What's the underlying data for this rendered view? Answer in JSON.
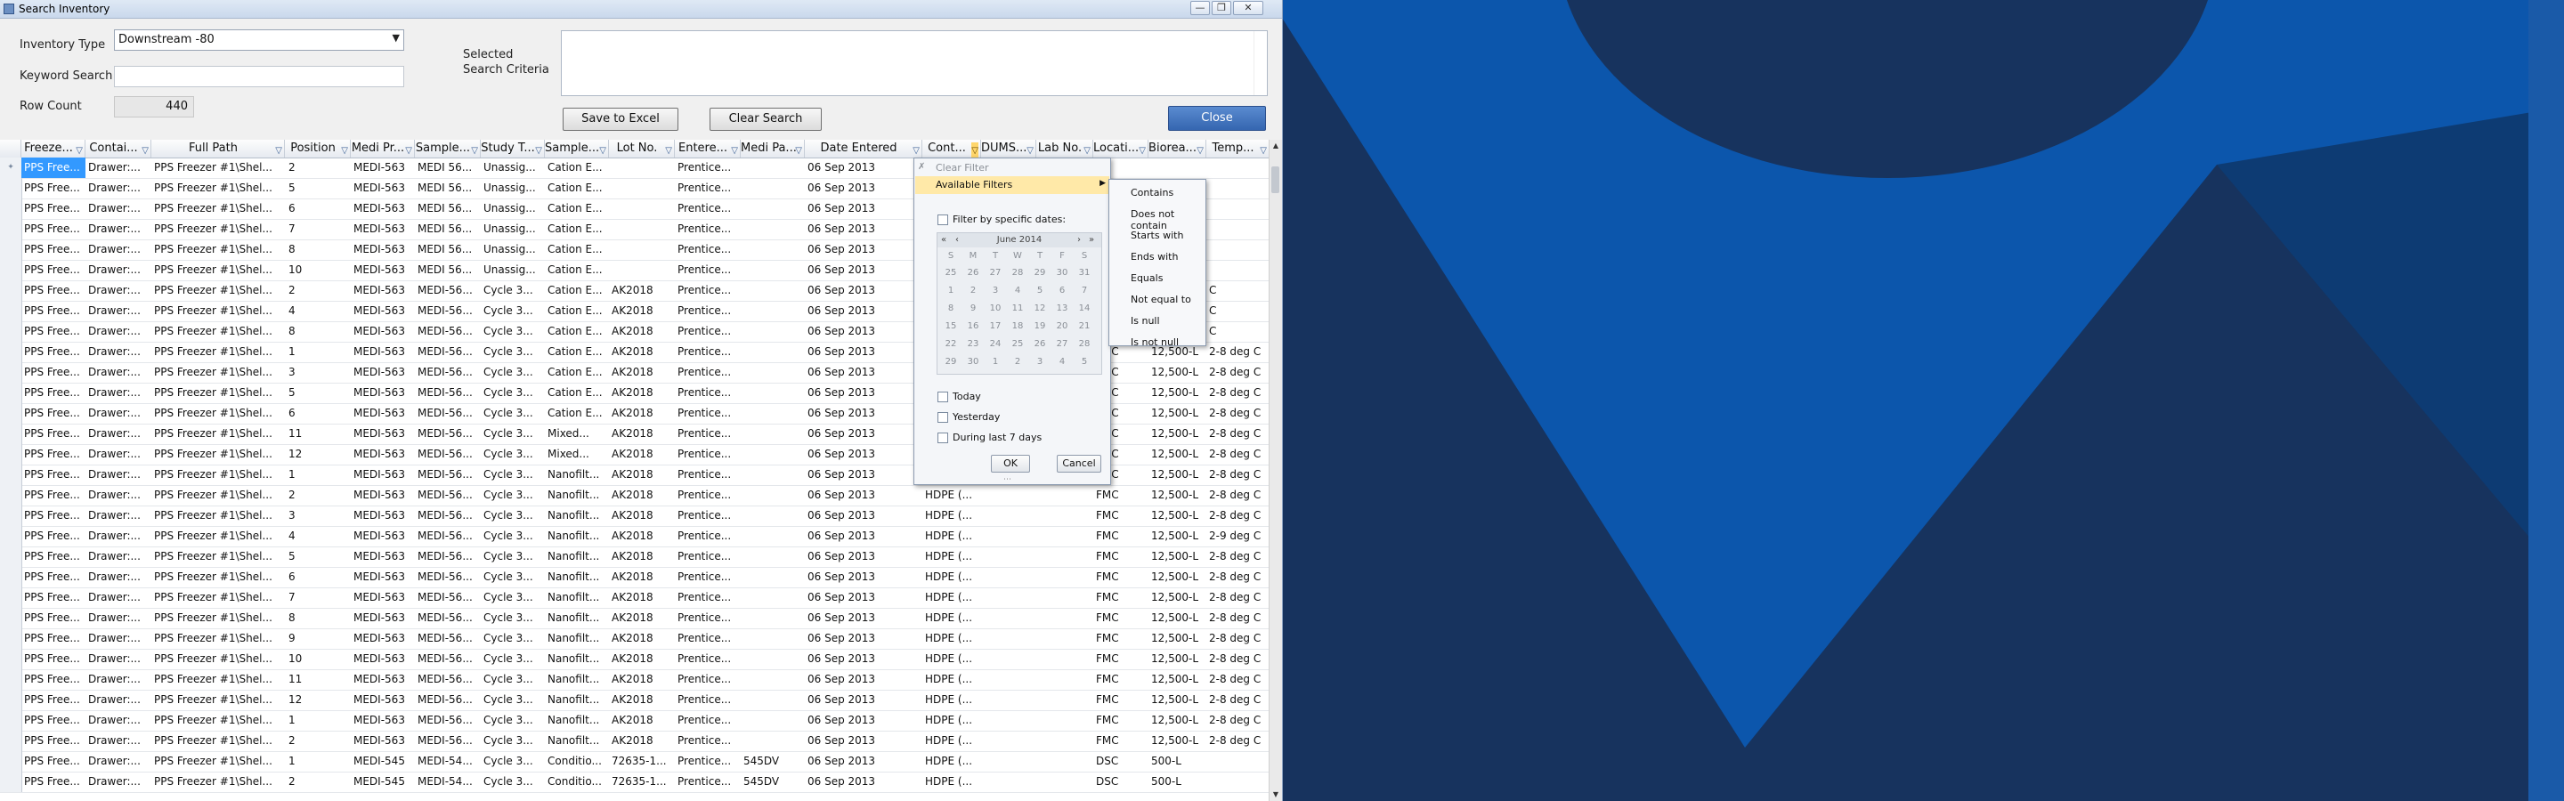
{
  "window": {
    "title": "Search Inventory"
  },
  "form": {
    "inventory_type_label": "Inventory Type",
    "inventory_type_value": "Downstream -80",
    "keyword_label": "Keyword Search",
    "keyword_value": "",
    "row_count_label": "Row Count",
    "row_count_value": "440",
    "selected_criteria_label_1": "Selected",
    "selected_criteria_label_2": "Search Criteria",
    "save_excel": "Save to Excel",
    "clear_search": "Clear Search",
    "close": "Close"
  },
  "grid": {
    "headers": [
      "Freeze...",
      "Contai...",
      "Full Path",
      "Position",
      "Medi Pr...",
      "Sample...",
      "Study T...",
      "Sample...",
      "Lot No.",
      "Entere...",
      "Medi Pa...",
      "Date Entered",
      "Cont...",
      "DUMS...",
      "Lab No.",
      "Locati...",
      "Biorea...",
      "Temp..."
    ],
    "rows": [
      [
        "PPS Free...",
        "Drawer:...",
        "PPS Freezer #1\\Shel...",
        "2",
        "MEDI-563",
        "MEDI 56...",
        "Unassig...",
        "Cation E...",
        "",
        "Prentice...",
        "",
        "06 Sep 2013",
        "",
        "",
        "",
        "",
        "",
        ""
      ],
      [
        "PPS Free...",
        "Drawer:...",
        "PPS Freezer #1\\Shel...",
        "5",
        "MEDI-563",
        "MEDI 56...",
        "Unassig...",
        "Cation E...",
        "",
        "Prentice...",
        "",
        "06 Sep 2013",
        "",
        "",
        "",
        "",
        "",
        ""
      ],
      [
        "PPS Free...",
        "Drawer:...",
        "PPS Freezer #1\\Shel...",
        "6",
        "MEDI-563",
        "MEDI 56...",
        "Unassig...",
        "Cation E...",
        "",
        "Prentice...",
        "",
        "06 Sep 2013",
        "",
        "",
        "",
        "",
        "",
        ""
      ],
      [
        "PPS Free...",
        "Drawer:...",
        "PPS Freezer #1\\Shel...",
        "7",
        "MEDI-563",
        "MEDI 56...",
        "Unassig...",
        "Cation E...",
        "",
        "Prentice...",
        "",
        "06 Sep 2013",
        "",
        "",
        "",
        "",
        "",
        ""
      ],
      [
        "PPS Free...",
        "Drawer:...",
        "PPS Freezer #1\\Shel...",
        "8",
        "MEDI-563",
        "MEDI 56...",
        "Unassig...",
        "Cation E...",
        "",
        "Prentice...",
        "",
        "06 Sep 2013",
        "",
        "",
        "",
        "",
        "",
        ""
      ],
      [
        "PPS Free...",
        "Drawer:...",
        "PPS Freezer #1\\Shel...",
        "10",
        "MEDI-563",
        "MEDI 56...",
        "Unassig...",
        "Cation E...",
        "",
        "Prentice...",
        "",
        "06 Sep 2013",
        "",
        "",
        "",
        "",
        "",
        ""
      ],
      [
        "PPS Free...",
        "Drawer:...",
        "PPS Freezer #1\\Shel...",
        "2",
        "MEDI-563",
        "MEDI-56...",
        "Cycle 3...",
        "Cation E...",
        "AK2018",
        "Prentice...",
        "",
        "06 Sep 2013",
        "",
        "",
        "",
        "",
        "",
        "C"
      ],
      [
        "PPS Free...",
        "Drawer:...",
        "PPS Freezer #1\\Shel...",
        "4",
        "MEDI-563",
        "MEDI-56...",
        "Cycle 3...",
        "Cation E...",
        "AK2018",
        "Prentice...",
        "",
        "06 Sep 2013",
        "",
        "",
        "",
        "",
        "",
        "C"
      ],
      [
        "PPS Free...",
        "Drawer:...",
        "PPS Freezer #1\\Shel...",
        "8",
        "MEDI-563",
        "MEDI-56...",
        "Cycle 3...",
        "Cation E...",
        "AK2018",
        "Prentice...",
        "",
        "06 Sep 2013",
        "",
        "",
        "",
        "",
        "",
        "C"
      ],
      [
        "PPS Free...",
        "Drawer:...",
        "PPS Freezer #1\\Shel...",
        "1",
        "MEDI-563",
        "MEDI-56...",
        "Cycle 3...",
        "Cation E...",
        "AK2018",
        "Prentice...",
        "",
        "06 Sep 2013",
        "",
        "",
        "",
        "FMC",
        "12,500-L",
        "2-8 deg C"
      ],
      [
        "PPS Free...",
        "Drawer:...",
        "PPS Freezer #1\\Shel...",
        "3",
        "MEDI-563",
        "MEDI-56...",
        "Cycle 3...",
        "Cation E...",
        "AK2018",
        "Prentice...",
        "",
        "06 Sep 2013",
        "",
        "",
        "",
        "FMC",
        "12,500-L",
        "2-8 deg C"
      ],
      [
        "PPS Free...",
        "Drawer:...",
        "PPS Freezer #1\\Shel...",
        "5",
        "MEDI-563",
        "MEDI-56...",
        "Cycle 3...",
        "Cation E...",
        "AK2018",
        "Prentice...",
        "",
        "06 Sep 2013",
        "",
        "",
        "",
        "FMC",
        "12,500-L",
        "2-8 deg C"
      ],
      [
        "PPS Free...",
        "Drawer:...",
        "PPS Freezer #1\\Shel...",
        "6",
        "MEDI-563",
        "MEDI-56...",
        "Cycle 3...",
        "Cation E...",
        "AK2018",
        "Prentice...",
        "",
        "06 Sep 2013",
        "",
        "",
        "",
        "FMC",
        "12,500-L",
        "2-8 deg C"
      ],
      [
        "PPS Free...",
        "Drawer:...",
        "PPS Freezer #1\\Shel...",
        "11",
        "MEDI-563",
        "MEDI-56...",
        "Cycle 3...",
        "Mixed...",
        "AK2018",
        "Prentice...",
        "",
        "06 Sep 2013",
        "",
        "",
        "",
        "FMC",
        "12,500-L",
        "2-8 deg C"
      ],
      [
        "PPS Free...",
        "Drawer:...",
        "PPS Freezer #1\\Shel...",
        "12",
        "MEDI-563",
        "MEDI-56...",
        "Cycle 3...",
        "Mixed...",
        "AK2018",
        "Prentice...",
        "",
        "06 Sep 2013",
        "",
        "",
        "",
        "FMC",
        "12,500-L",
        "2-8 deg C"
      ],
      [
        "PPS Free...",
        "Drawer:...",
        "PPS Freezer #1\\Shel...",
        "1",
        "MEDI-563",
        "MEDI-56...",
        "Cycle 3...",
        "Nanofilt...",
        "AK2018",
        "Prentice...",
        "",
        "06 Sep 2013",
        "",
        "",
        "",
        "FMC",
        "12,500-L",
        "2-8 deg C"
      ],
      [
        "PPS Free...",
        "Drawer:...",
        "PPS Freezer #1\\Shel...",
        "2",
        "MEDI-563",
        "MEDI-56...",
        "Cycle 3...",
        "Nanofilt...",
        "AK2018",
        "Prentice...",
        "",
        "06 Sep 2013",
        "HDPE (...",
        "",
        "",
        "FMC",
        "12,500-L",
        "2-8 deg C"
      ],
      [
        "PPS Free...",
        "Drawer:...",
        "PPS Freezer #1\\Shel...",
        "3",
        "MEDI-563",
        "MEDI-56...",
        "Cycle 3...",
        "Nanofilt...",
        "AK2018",
        "Prentice...",
        "",
        "06 Sep 2013",
        "HDPE (...",
        "",
        "",
        "FMC",
        "12,500-L",
        "2-8 deg C"
      ],
      [
        "PPS Free...",
        "Drawer:...",
        "PPS Freezer #1\\Shel...",
        "4",
        "MEDI-563",
        "MEDI-56...",
        "Cycle 3...",
        "Nanofilt...",
        "AK2018",
        "Prentice...",
        "",
        "06 Sep 2013",
        "HDPE (...",
        "",
        "",
        "FMC",
        "12,500-L",
        "2-9 deg C"
      ],
      [
        "PPS Free...",
        "Drawer:...",
        "PPS Freezer #1\\Shel...",
        "5",
        "MEDI-563",
        "MEDI-56...",
        "Cycle 3...",
        "Nanofilt...",
        "AK2018",
        "Prentice...",
        "",
        "06 Sep 2013",
        "HDPE (...",
        "",
        "",
        "FMC",
        "12,500-L",
        "2-8 deg C"
      ],
      [
        "PPS Free...",
        "Drawer:...",
        "PPS Freezer #1\\Shel...",
        "6",
        "MEDI-563",
        "MEDI-56...",
        "Cycle 3...",
        "Nanofilt...",
        "AK2018",
        "Prentice...",
        "",
        "06 Sep 2013",
        "HDPE (...",
        "",
        "",
        "FMC",
        "12,500-L",
        "2-8 deg C"
      ],
      [
        "PPS Free...",
        "Drawer:...",
        "PPS Freezer #1\\Shel...",
        "7",
        "MEDI-563",
        "MEDI-56...",
        "Cycle 3...",
        "Nanofilt...",
        "AK2018",
        "Prentice...",
        "",
        "06 Sep 2013",
        "HDPE (...",
        "",
        "",
        "FMC",
        "12,500-L",
        "2-8 deg C"
      ],
      [
        "PPS Free...",
        "Drawer:...",
        "PPS Freezer #1\\Shel...",
        "8",
        "MEDI-563",
        "MEDI-56...",
        "Cycle 3...",
        "Nanofilt...",
        "AK2018",
        "Prentice...",
        "",
        "06 Sep 2013",
        "HDPE (...",
        "",
        "",
        "FMC",
        "12,500-L",
        "2-8 deg C"
      ],
      [
        "PPS Free...",
        "Drawer:...",
        "PPS Freezer #1\\Shel...",
        "9",
        "MEDI-563",
        "MEDI-56...",
        "Cycle 3...",
        "Nanofilt...",
        "AK2018",
        "Prentice...",
        "",
        "06 Sep 2013",
        "HDPE (...",
        "",
        "",
        "FMC",
        "12,500-L",
        "2-8 deg C"
      ],
      [
        "PPS Free...",
        "Drawer:...",
        "PPS Freezer #1\\Shel...",
        "10",
        "MEDI-563",
        "MEDI-56...",
        "Cycle 3...",
        "Nanofilt...",
        "AK2018",
        "Prentice...",
        "",
        "06 Sep 2013",
        "HDPE (...",
        "",
        "",
        "FMC",
        "12,500-L",
        "2-8 deg C"
      ],
      [
        "PPS Free...",
        "Drawer:...",
        "PPS Freezer #1\\Shel...",
        "11",
        "MEDI-563",
        "MEDI-56...",
        "Cycle 3...",
        "Nanofilt...",
        "AK2018",
        "Prentice...",
        "",
        "06 Sep 2013",
        "HDPE (...",
        "",
        "",
        "FMC",
        "12,500-L",
        "2-8 deg C"
      ],
      [
        "PPS Free...",
        "Drawer:...",
        "PPS Freezer #1\\Shel...",
        "12",
        "MEDI-563",
        "MEDI-56...",
        "Cycle 3...",
        "Nanofilt...",
        "AK2018",
        "Prentice...",
        "",
        "06 Sep 2013",
        "HDPE (...",
        "",
        "",
        "FMC",
        "12,500-L",
        "2-8 deg C"
      ],
      [
        "PPS Free...",
        "Drawer:...",
        "PPS Freezer #1\\Shel...",
        "1",
        "MEDI-563",
        "MEDI-56...",
        "Cycle 3...",
        "Nanofilt...",
        "AK2018",
        "Prentice...",
        "",
        "06 Sep 2013",
        "HDPE (...",
        "",
        "",
        "FMC",
        "12,500-L",
        "2-8 deg C"
      ],
      [
        "PPS Free...",
        "Drawer:...",
        "PPS Freezer #1\\Shel...",
        "2",
        "MEDI-563",
        "MEDI-56...",
        "Cycle 3...",
        "Nanofilt...",
        "AK2018",
        "Prentice...",
        "",
        "06 Sep 2013",
        "HDPE (...",
        "",
        "",
        "FMC",
        "12,500-L",
        "2-8 deg C"
      ],
      [
        "PPS Free...",
        "Drawer:...",
        "PPS Freezer #1\\Shel...",
        "1",
        "MEDI-545",
        "MEDI-54...",
        "Cycle 3...",
        "Conditio...",
        "72635-1...",
        "Prentice...",
        "545DV",
        "06 Sep 2013",
        "HDPE (...",
        "",
        "",
        "DSC",
        "500-L",
        ""
      ],
      [
        "PPS Free...",
        "Drawer:...",
        "PPS Freezer #1\\Shel...",
        "2",
        "MEDI-545",
        "MEDI-54...",
        "Cycle 3...",
        "Conditio...",
        "72635-1...",
        "Prentice...",
        "545DV",
        "06 Sep 2013",
        "HDPE (...",
        "",
        "",
        "DSC",
        "500-L",
        ""
      ]
    ]
  },
  "filter_popup": {
    "clear_filter": "Clear Filter",
    "available_filters": "Available Filters",
    "filter_by_dates": "Filter by specific dates:",
    "calendar_month": "June 2014",
    "days_of_week": [
      "S",
      "M",
      "T",
      "W",
      "T",
      "F",
      "S"
    ],
    "calendar_days": [
      "25",
      "26",
      "27",
      "28",
      "29",
      "30",
      "31",
      "1",
      "2",
      "3",
      "4",
      "5",
      "6",
      "7",
      "8",
      "9",
      "10",
      "11",
      "12",
      "13",
      "14",
      "15",
      "16",
      "17",
      "18",
      "19",
      "20",
      "21",
      "22",
      "23",
      "24",
      "25",
      "26",
      "27",
      "28",
      "29",
      "30",
      "1",
      "2",
      "3",
      "4",
      "5"
    ],
    "today": "Today",
    "yesterday": "Yesterday",
    "last7": "During last 7 days",
    "ok": "OK",
    "cancel": "Cancel"
  },
  "submenu": {
    "items": [
      "Contains",
      "Does not contain",
      "Starts with",
      "Ends with",
      "Equals",
      "Not equal to",
      "Is null",
      "Is not null"
    ]
  },
  "colors": {
    "desktop_bg": "#0d3b73",
    "selection": "#3399ff",
    "close_button": "#3f6fb8"
  }
}
